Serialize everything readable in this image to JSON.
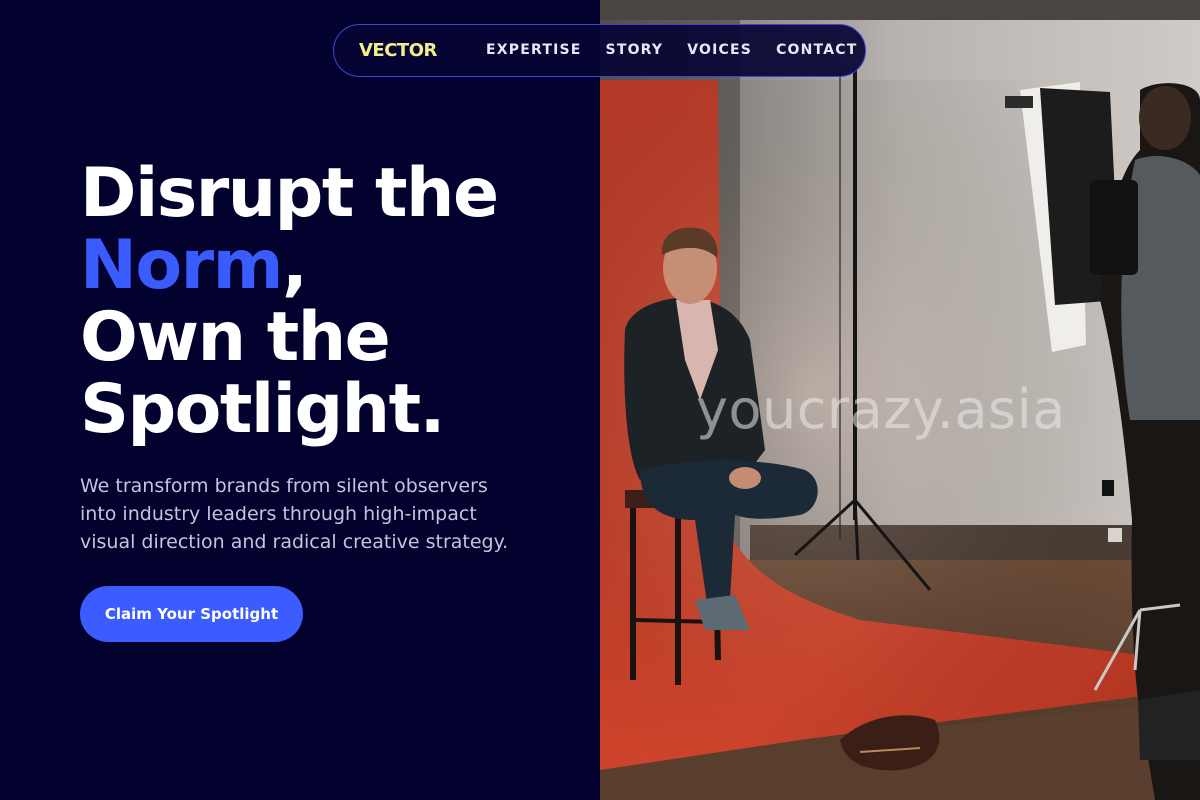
{
  "brand": {
    "logo_text": "VECTOR"
  },
  "nav": {
    "links": [
      "EXPERTISE",
      "STORY",
      "VOICES",
      "CONTACT"
    ]
  },
  "hero": {
    "title_line1": "Disrupt the",
    "title_accent": "Norm",
    "title_comma": ",",
    "title_line3": "Own the",
    "title_line4": "Spotlight.",
    "subtitle": "We transform brands from silent observers into industry leaders through high-impact visual direction and radical creative strategy.",
    "cta_label": "Claim Your Spotlight"
  },
  "photo": {
    "watermark": "youcrazy.asia"
  },
  "colors": {
    "background": "#03012e",
    "accent": "#3b5cff",
    "logo": "#f3ee8a",
    "nav_border": "#3a47d8"
  }
}
